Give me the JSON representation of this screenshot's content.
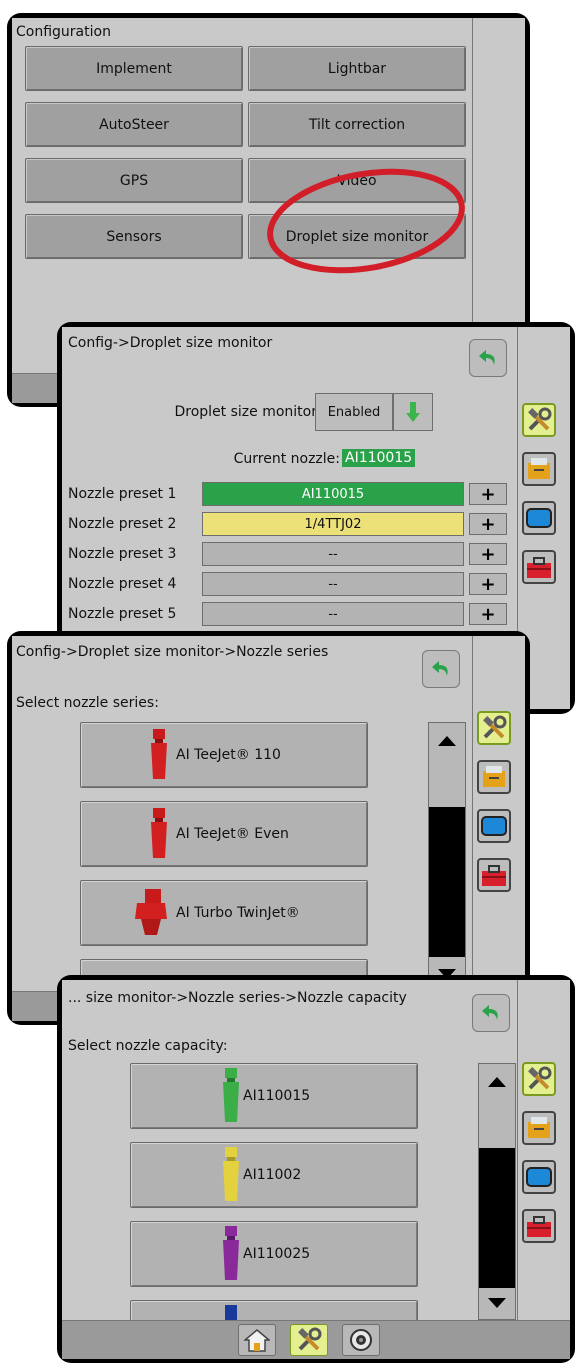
{
  "panel1": {
    "title": "Configuration",
    "buttons": [
      "Implement",
      "Lightbar",
      "AutoSteer",
      "Tilt correction",
      "GPS",
      "Video",
      "Sensors",
      "Droplet size monitor"
    ]
  },
  "panel2": {
    "title": "Config->Droplet size monitor",
    "dsm_label": "Droplet size monitor",
    "dsm_value": "Enabled",
    "current_label": "Current nozzle:",
    "current_value": "AI110015",
    "presets": [
      {
        "label": "Nozzle preset 1",
        "value": "AI110015",
        "color": "#2aa24a"
      },
      {
        "label": "Nozzle preset 2",
        "value": "1/4TTJ02",
        "color": "#ece078"
      },
      {
        "label": "Nozzle preset 3",
        "value": "--",
        "color": "#b3b3b3"
      },
      {
        "label": "Nozzle preset 4",
        "value": "--",
        "color": "#b3b3b3"
      },
      {
        "label": "Nozzle preset 5",
        "value": "--",
        "color": "#b3b3b3"
      }
    ],
    "plus": "+"
  },
  "panel3": {
    "title": "Config->Droplet size monitor->Nozzle series",
    "prompt": "Select nozzle series:",
    "items": [
      "AI TeeJet® 110",
      "AI TeeJet® Even",
      "AI Turbo TwinJet®"
    ]
  },
  "panel4": {
    "title": "... size monitor->Nozzle series->Nozzle capacity",
    "prompt": "Select nozzle capacity:",
    "items": [
      {
        "label": "AI110015",
        "color": "#3cae48"
      },
      {
        "label": "AI11002",
        "color": "#e3d23e"
      },
      {
        "label": "AI110025",
        "color": "#8a2a9a"
      }
    ]
  },
  "colors": {
    "highlight_green": "#2aa24a",
    "highlight_yellow": "#ece078",
    "annotation_red": "#d21e28",
    "active_tab": "#e4f090"
  },
  "icons": [
    "tools-icon",
    "console-icon",
    "monitor-icon",
    "toolbox-icon",
    "back-arrow-icon",
    "home-icon",
    "camera-icon"
  ]
}
